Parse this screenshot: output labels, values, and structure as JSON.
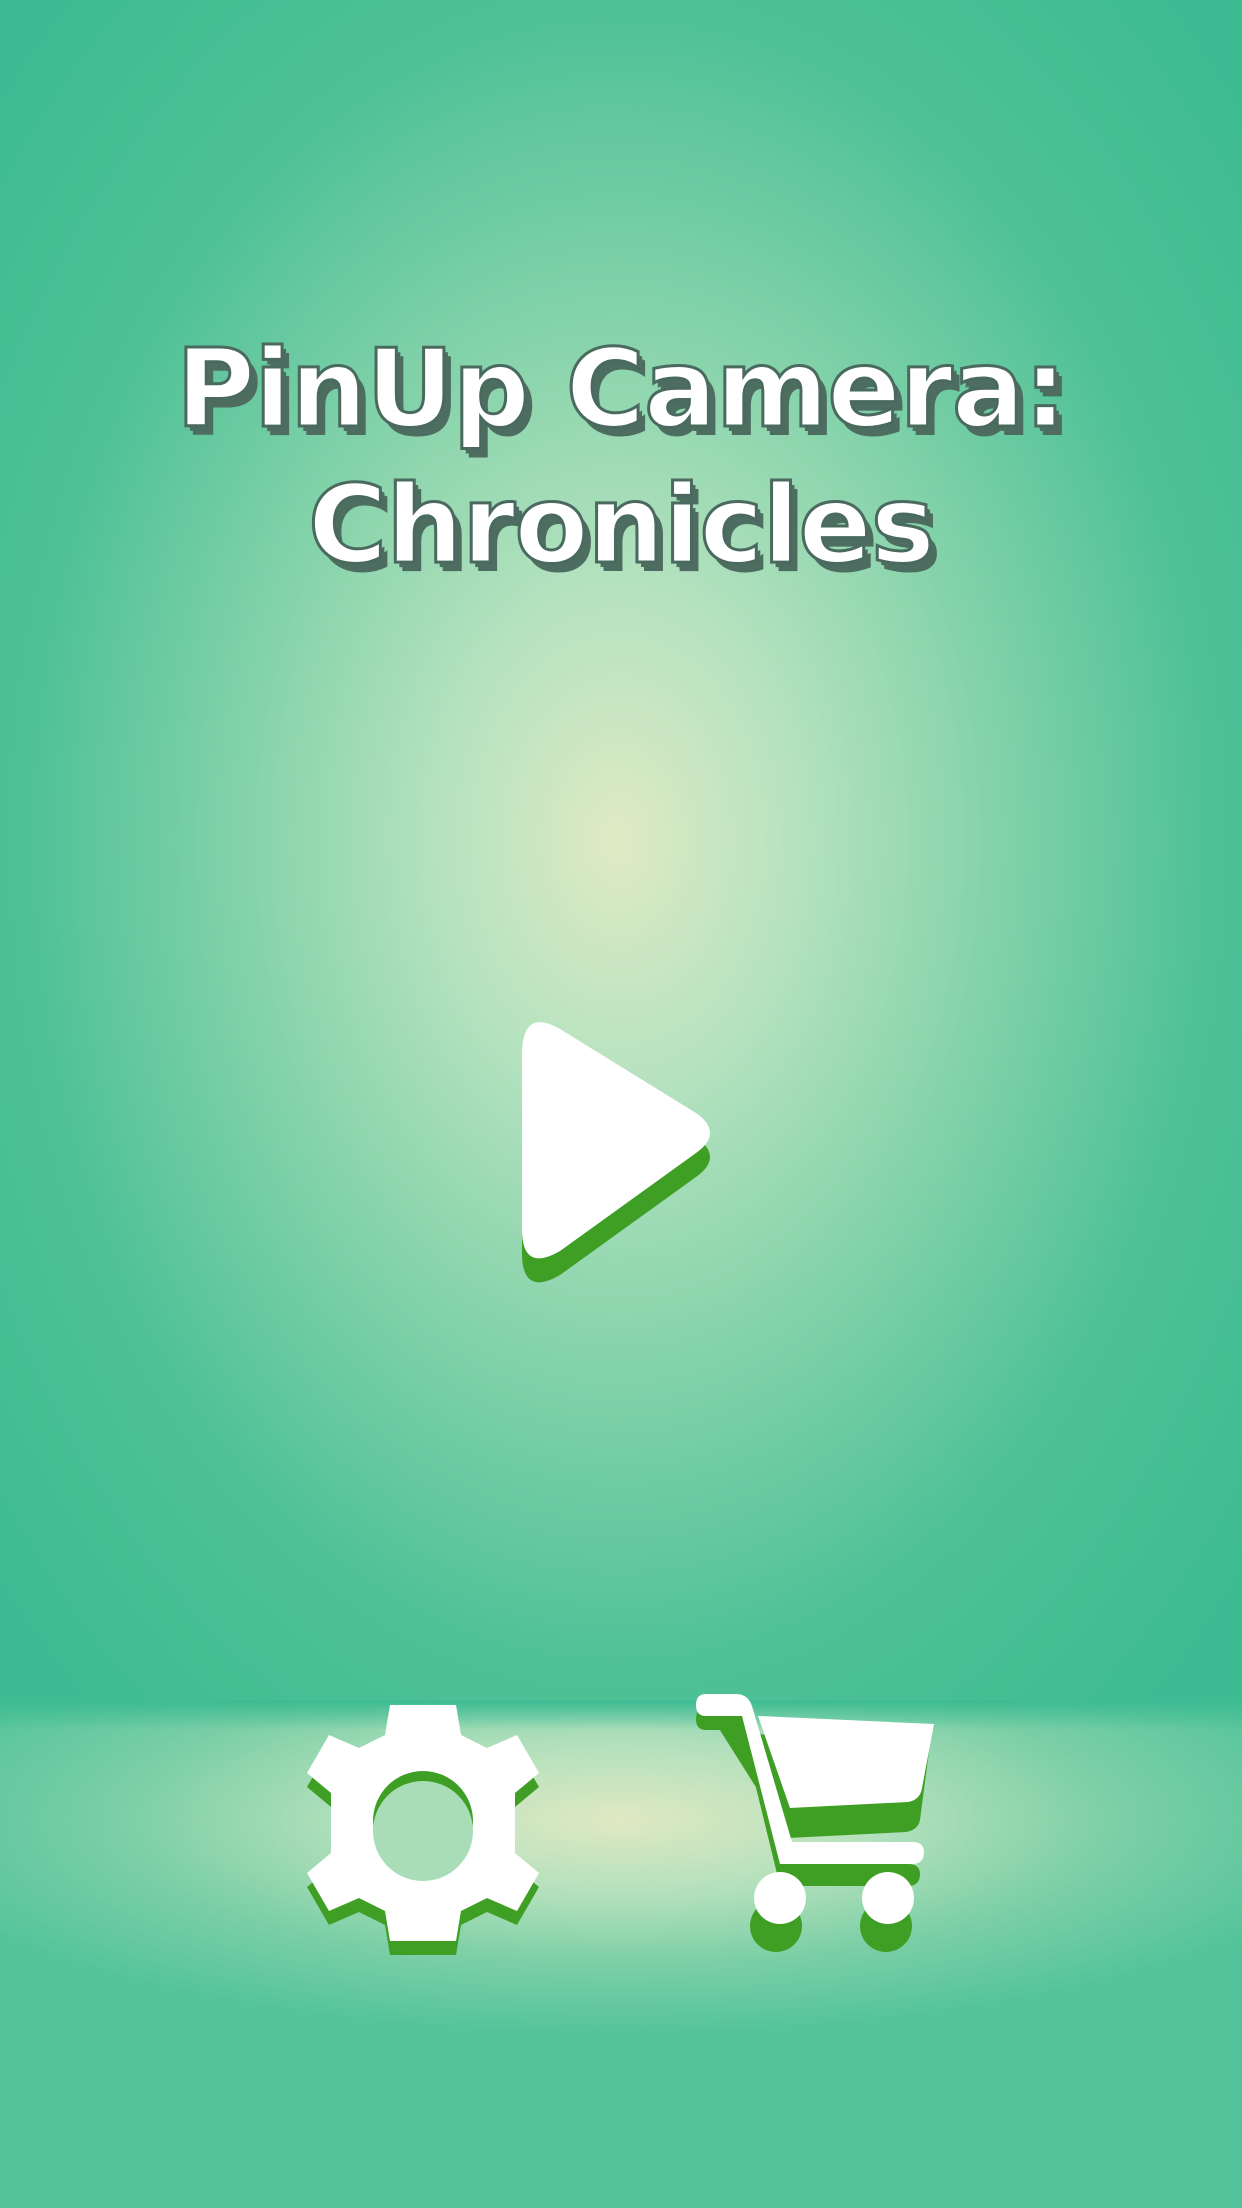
{
  "title": {
    "line1": "PinUp Camera:",
    "line2": "Chronicles"
  },
  "buttons": {
    "play": {
      "icon": "play-icon"
    },
    "settings": {
      "icon": "gear-icon"
    },
    "shop": {
      "icon": "cart-icon"
    }
  },
  "colors": {
    "background": "#3dbb92",
    "glow": "#dfeac4",
    "icon_fill": "#ffffff",
    "icon_shadow": "#3f9f24",
    "title_shadow": "#4e6d61"
  }
}
